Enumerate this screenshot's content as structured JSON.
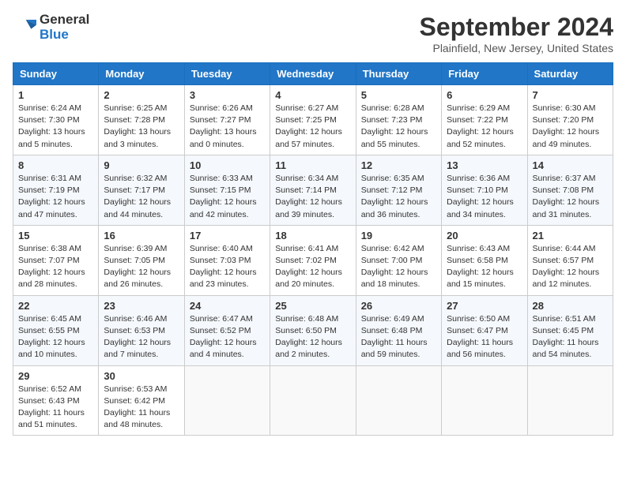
{
  "logo": {
    "general": "General",
    "blue": "Blue"
  },
  "title": {
    "month": "September 2024",
    "location": "Plainfield, New Jersey, United States"
  },
  "headers": [
    "Sunday",
    "Monday",
    "Tuesday",
    "Wednesday",
    "Thursday",
    "Friday",
    "Saturday"
  ],
  "weeks": [
    [
      {
        "day": "1",
        "sunrise": "6:24 AM",
        "sunset": "7:30 PM",
        "daylight": "13 hours and 5 minutes."
      },
      {
        "day": "2",
        "sunrise": "6:25 AM",
        "sunset": "7:28 PM",
        "daylight": "13 hours and 3 minutes."
      },
      {
        "day": "3",
        "sunrise": "6:26 AM",
        "sunset": "7:27 PM",
        "daylight": "13 hours and 0 minutes."
      },
      {
        "day": "4",
        "sunrise": "6:27 AM",
        "sunset": "7:25 PM",
        "daylight": "12 hours and 57 minutes."
      },
      {
        "day": "5",
        "sunrise": "6:28 AM",
        "sunset": "7:23 PM",
        "daylight": "12 hours and 55 minutes."
      },
      {
        "day": "6",
        "sunrise": "6:29 AM",
        "sunset": "7:22 PM",
        "daylight": "12 hours and 52 minutes."
      },
      {
        "day": "7",
        "sunrise": "6:30 AM",
        "sunset": "7:20 PM",
        "daylight": "12 hours and 49 minutes."
      }
    ],
    [
      {
        "day": "8",
        "sunrise": "6:31 AM",
        "sunset": "7:19 PM",
        "daylight": "12 hours and 47 minutes."
      },
      {
        "day": "9",
        "sunrise": "6:32 AM",
        "sunset": "7:17 PM",
        "daylight": "12 hours and 44 minutes."
      },
      {
        "day": "10",
        "sunrise": "6:33 AM",
        "sunset": "7:15 PM",
        "daylight": "12 hours and 42 minutes."
      },
      {
        "day": "11",
        "sunrise": "6:34 AM",
        "sunset": "7:14 PM",
        "daylight": "12 hours and 39 minutes."
      },
      {
        "day": "12",
        "sunrise": "6:35 AM",
        "sunset": "7:12 PM",
        "daylight": "12 hours and 36 minutes."
      },
      {
        "day": "13",
        "sunrise": "6:36 AM",
        "sunset": "7:10 PM",
        "daylight": "12 hours and 34 minutes."
      },
      {
        "day": "14",
        "sunrise": "6:37 AM",
        "sunset": "7:08 PM",
        "daylight": "12 hours and 31 minutes."
      }
    ],
    [
      {
        "day": "15",
        "sunrise": "6:38 AM",
        "sunset": "7:07 PM",
        "daylight": "12 hours and 28 minutes."
      },
      {
        "day": "16",
        "sunrise": "6:39 AM",
        "sunset": "7:05 PM",
        "daylight": "12 hours and 26 minutes."
      },
      {
        "day": "17",
        "sunrise": "6:40 AM",
        "sunset": "7:03 PM",
        "daylight": "12 hours and 23 minutes."
      },
      {
        "day": "18",
        "sunrise": "6:41 AM",
        "sunset": "7:02 PM",
        "daylight": "12 hours and 20 minutes."
      },
      {
        "day": "19",
        "sunrise": "6:42 AM",
        "sunset": "7:00 PM",
        "daylight": "12 hours and 18 minutes."
      },
      {
        "day": "20",
        "sunrise": "6:43 AM",
        "sunset": "6:58 PM",
        "daylight": "12 hours and 15 minutes."
      },
      {
        "day": "21",
        "sunrise": "6:44 AM",
        "sunset": "6:57 PM",
        "daylight": "12 hours and 12 minutes."
      }
    ],
    [
      {
        "day": "22",
        "sunrise": "6:45 AM",
        "sunset": "6:55 PM",
        "daylight": "12 hours and 10 minutes."
      },
      {
        "day": "23",
        "sunrise": "6:46 AM",
        "sunset": "6:53 PM",
        "daylight": "12 hours and 7 minutes."
      },
      {
        "day": "24",
        "sunrise": "6:47 AM",
        "sunset": "6:52 PM",
        "daylight": "12 hours and 4 minutes."
      },
      {
        "day": "25",
        "sunrise": "6:48 AM",
        "sunset": "6:50 PM",
        "daylight": "12 hours and 2 minutes."
      },
      {
        "day": "26",
        "sunrise": "6:49 AM",
        "sunset": "6:48 PM",
        "daylight": "11 hours and 59 minutes."
      },
      {
        "day": "27",
        "sunrise": "6:50 AM",
        "sunset": "6:47 PM",
        "daylight": "11 hours and 56 minutes."
      },
      {
        "day": "28",
        "sunrise": "6:51 AM",
        "sunset": "6:45 PM",
        "daylight": "11 hours and 54 minutes."
      }
    ],
    [
      {
        "day": "29",
        "sunrise": "6:52 AM",
        "sunset": "6:43 PM",
        "daylight": "11 hours and 51 minutes."
      },
      {
        "day": "30",
        "sunrise": "6:53 AM",
        "sunset": "6:42 PM",
        "daylight": "11 hours and 48 minutes."
      },
      null,
      null,
      null,
      null,
      null
    ]
  ]
}
